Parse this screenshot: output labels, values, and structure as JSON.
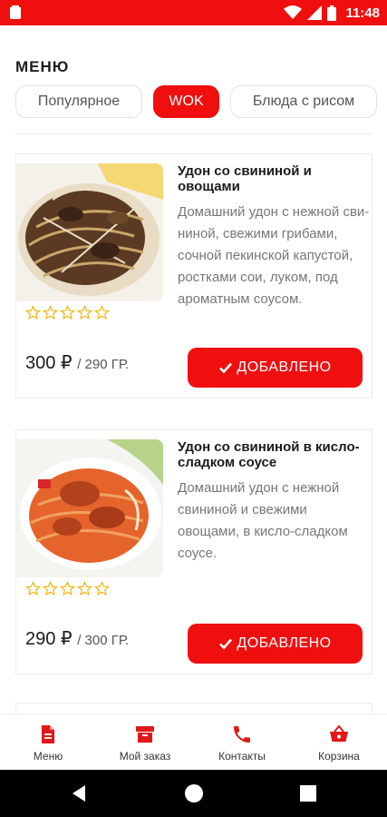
{
  "status_bar": {
    "time": "11:48",
    "icons": [
      "notification-icon",
      "wifi-icon",
      "signal-icon",
      "battery-icon"
    ]
  },
  "menu": {
    "title": "МЕНЮ"
  },
  "tabs": [
    {
      "label": "Популярное",
      "active": false
    },
    {
      "label": "WOK",
      "active": true
    },
    {
      "label": "Блюда с рисом",
      "active": false
    }
  ],
  "products": [
    {
      "name": "Удон со свининой и овощами",
      "description": "Домашний удон с нежной сви- ниной, свежими грибами, сочной пекинской капустой, ростками сои, луком, под ароматным соусом.",
      "price": "300 ₽",
      "weight": "/ 290 ГР.",
      "rating": 0,
      "button_label": "ДОБАВЛЕНО"
    },
    {
      "name": "Удон со свининой в кисло-сладком соусе",
      "description": "Домашний удон с нежной свининой и свежими овощами, в кисло-сладком соусе.",
      "price": "290 ₽",
      "weight": "/ 300 ГР.",
      "rating": 0,
      "button_label": "ДОБАВЛЕНО"
    }
  ],
  "bottom_nav": [
    {
      "label": "Меню",
      "icon": "document-icon"
    },
    {
      "label": "Мой заказ",
      "icon": "archive-box-icon"
    },
    {
      "label": "Контакты",
      "icon": "phone-icon"
    },
    {
      "label": "Корзина",
      "icon": "basket-icon"
    }
  ],
  "colors": {
    "accent": "#f00f0f",
    "star": "#f2b100",
    "text_muted": "#777777"
  }
}
